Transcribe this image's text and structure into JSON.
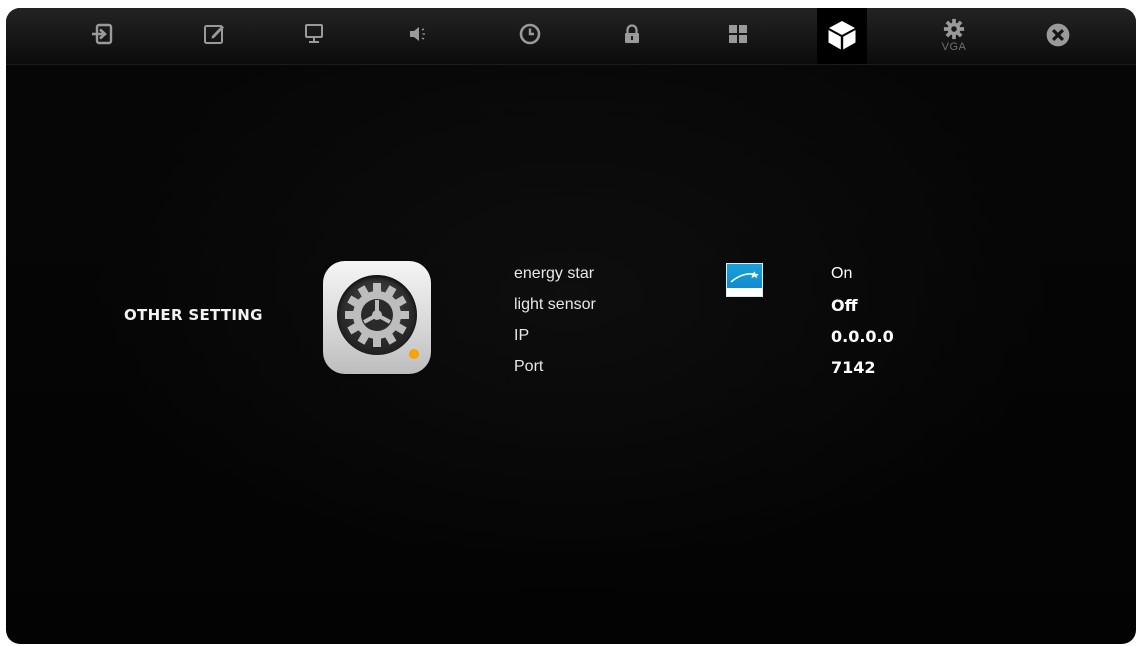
{
  "toolbar": {
    "tabs": [
      {
        "name": "input",
        "icon": "input-icon"
      },
      {
        "name": "edit",
        "icon": "edit-icon"
      },
      {
        "name": "display",
        "icon": "monitor-icon"
      },
      {
        "name": "audio",
        "icon": "speaker-icon"
      },
      {
        "name": "time",
        "icon": "clock-icon"
      },
      {
        "name": "lock",
        "icon": "lock-icon"
      },
      {
        "name": "layout",
        "icon": "grid-icon"
      },
      {
        "name": "other",
        "icon": "cube-icon",
        "active": true
      },
      {
        "name": "vga",
        "icon": "gear-icon",
        "label": "VGA"
      },
      {
        "name": "close",
        "icon": "close-icon"
      }
    ]
  },
  "section": {
    "title": "OTHER SETTING",
    "icon": "settings-gear-icon"
  },
  "settings": [
    {
      "label": "energy star",
      "value": "On"
    },
    {
      "label": "light sensor",
      "value": "Off"
    },
    {
      "label": "IP",
      "value": "0.0.0.0"
    },
    {
      "label": "Port",
      "value": "7142"
    }
  ],
  "energy_star_logo": {
    "icon": "energy-star-logo"
  },
  "colors": {
    "background": "#050505",
    "toolbar": "#1a1a1a",
    "icon": "#9a9a9a",
    "active_icon": "#ffffff",
    "accent_dot": "#f5a400",
    "energy_logo": "#1aa1dc"
  }
}
